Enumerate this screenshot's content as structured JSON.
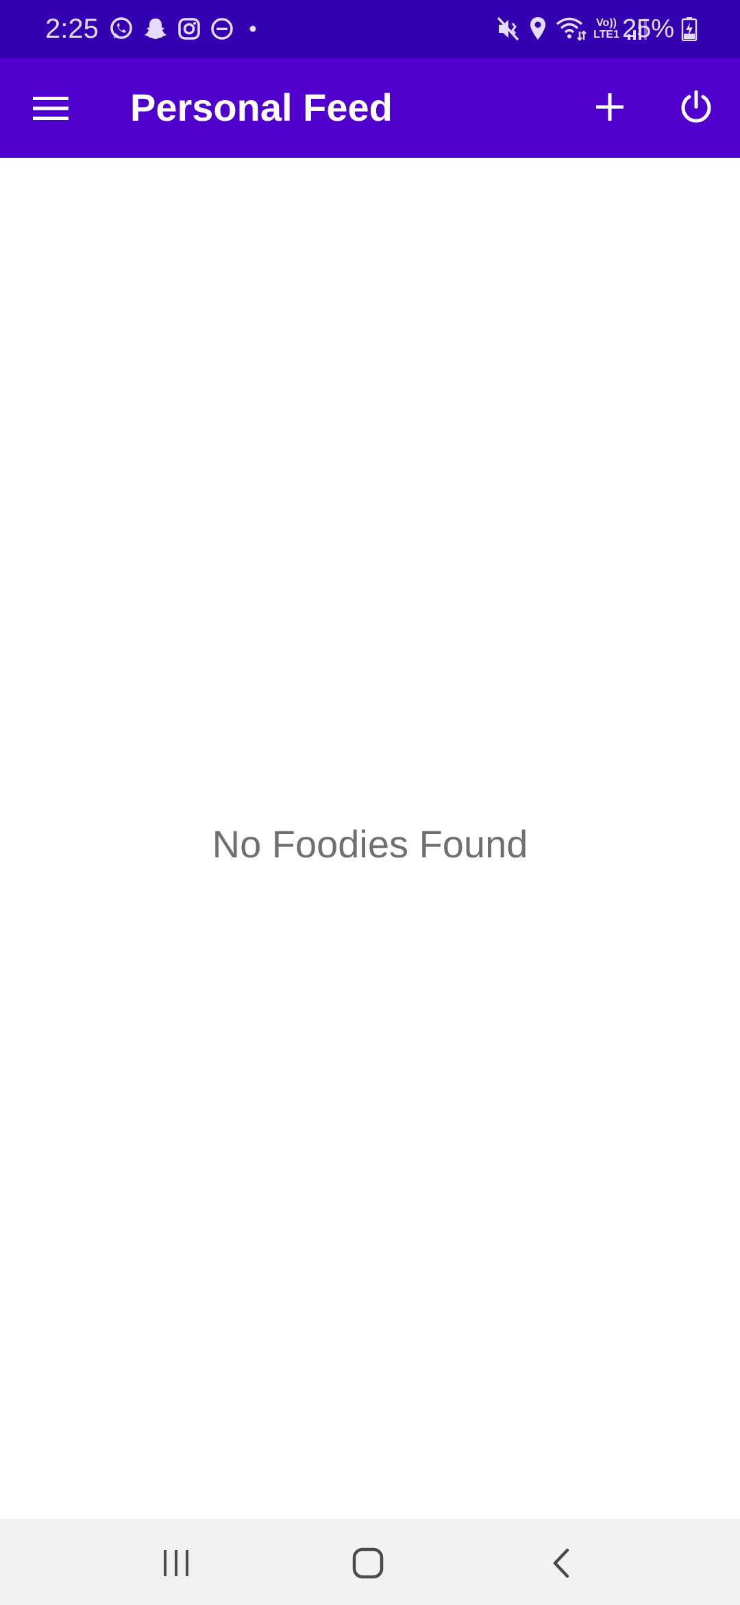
{
  "status_bar": {
    "time": "2:25",
    "battery_percent": "25%",
    "network_label_top": "Vo))",
    "network_label_bottom": "LTE1",
    "left_icons": [
      "whatsapp-icon",
      "snapchat-icon",
      "instagram-icon",
      "do-not-disturb-icon",
      "notification-dot-icon"
    ],
    "right_icons": [
      "mute-vibrate-icon",
      "location-icon",
      "wifi-icon",
      "volte-icon",
      "signal-icon",
      "battery-charging-icon"
    ]
  },
  "app_bar": {
    "title": "Personal Feed",
    "menu_icon": "menu-icon",
    "add_icon": "add-icon",
    "power_icon": "power-icon"
  },
  "content": {
    "empty_message": "No Foodies Found"
  },
  "nav_bar": {
    "recents_icon": "recents-icon",
    "home_icon": "home-icon",
    "back_icon": "back-icon"
  },
  "colors": {
    "status_bar": "#3500b0",
    "app_bar": "#5000cc",
    "empty_text": "#6f6f6f",
    "nav_bar": "#f2f2f2"
  }
}
